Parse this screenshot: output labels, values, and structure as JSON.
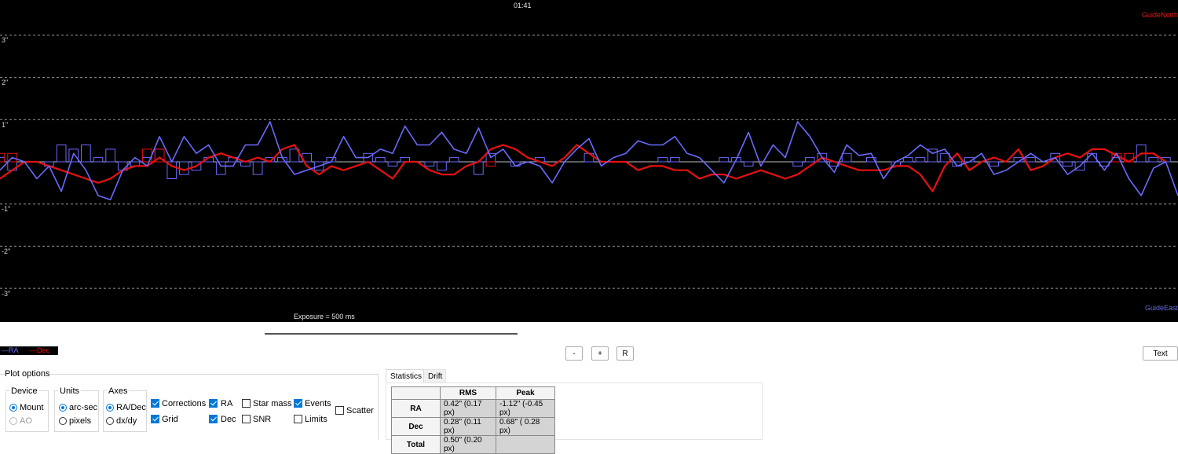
{
  "plot": {
    "time_label": "01:41",
    "y_ticks": [
      "3\"",
      "2\"",
      "1\"",
      "-1\"",
      "-2\"",
      "-3\""
    ],
    "guide_north": "GuideNorth",
    "guide_east": "GuideEast",
    "exposure": "Exposure = 500 ms",
    "colors": {
      "ra": "#6a6aff",
      "dec": "#e81010",
      "grid": "#9a9a9a",
      "background": "#000000"
    }
  },
  "legend": {
    "ra_label": "—RA",
    "dec_label": "—Dec"
  },
  "zoom_buttons": {
    "minus": "-",
    "plus": "+",
    "reset": "R"
  },
  "text_button": "Text",
  "plot_options": {
    "title": "Plot options",
    "device": {
      "title": "Device",
      "options": [
        "Mount",
        "AO"
      ],
      "selected": "Mount"
    },
    "units": {
      "title": "Units",
      "options": [
        "arc-sec",
        "pixels"
      ],
      "selected": "arc-sec"
    },
    "axes": {
      "title": "Axes",
      "options": [
        "RA/Dec",
        "dx/dy"
      ],
      "selected": "RA/Dec"
    },
    "checkboxes": [
      {
        "label": "Corrections",
        "checked": true
      },
      {
        "label": "Grid",
        "checked": true
      },
      {
        "label": "RA",
        "checked": true
      },
      {
        "label": "Dec",
        "checked": true
      },
      {
        "label": "Star mass",
        "checked": false
      },
      {
        "label": "SNR",
        "checked": false
      },
      {
        "label": "Events",
        "checked": true
      },
      {
        "label": "Limits",
        "checked": false
      },
      {
        "label": "Scatter",
        "checked": false
      }
    ]
  },
  "tabs": {
    "statistics": "Statistics",
    "drift": "Drift"
  },
  "stats": {
    "headers": [
      "RMS",
      "Peak"
    ],
    "rows": [
      {
        "label": "RA",
        "rms": "0.42\" (0.17 px)",
        "peak": "-1.12\" (-0.45 px)"
      },
      {
        "label": "Dec",
        "rms": "0.28\" (0.11 px)",
        "peak": "0.68\" ( 0.28 px)"
      },
      {
        "label": "Total",
        "rms": "0.50\" (0.20 px)",
        "peak": ""
      }
    ]
  },
  "chart_data": {
    "type": "line",
    "ylim": [
      -3.8,
      3.8
    ],
    "y_unit": "arc-sec",
    "series": [
      {
        "name": "RA",
        "values": [
          -0.2,
          0.1,
          0.0,
          -0.4,
          -0.1,
          -0.7,
          0.2,
          -0.2,
          -0.8,
          -0.9,
          -0.2,
          0.1,
          -0.1,
          0.6,
          0.0,
          0.6,
          0.2,
          0.4,
          -0.1,
          -0.1,
          0.4,
          0.4,
          0.95,
          0.1,
          -0.3,
          -0.2,
          -0.1,
          0.0,
          0.6,
          0.1,
          0.1,
          0.3,
          0.2,
          0.85,
          0.4,
          0.4,
          0.7,
          0.3,
          0.2,
          0.8,
          0.1,
          0.3,
          -0.1,
          0.0,
          -0.1,
          -0.5,
          0.0,
          0.3,
          0.55,
          -0.1,
          0.1,
          0.2,
          0.5,
          0.4,
          0.4,
          0.6,
          0.2,
          0.1,
          -0.2,
          -0.5,
          0.05,
          0.7,
          -0.1,
          0.4,
          0.1,
          0.95,
          0.6,
          0.1,
          -0.25,
          0.4,
          0.15,
          0.2,
          -0.4,
          0.0,
          0.15,
          0.4,
          0.2,
          0.3,
          -0.1,
          0.0,
          0.2,
          -0.3,
          -0.2,
          0.0,
          0.2,
          0.0,
          0.1,
          -0.3,
          -0.1,
          0.2,
          -0.2,
          0.2,
          -0.4,
          -0.8,
          -0.15,
          0.0,
          -0.8
        ]
      },
      {
        "name": "Dec",
        "values": [
          -0.4,
          -0.2,
          0.0,
          0.0,
          -0.1,
          -0.2,
          -0.3,
          -0.4,
          -0.5,
          -0.4,
          -0.2,
          -0.1,
          -0.1,
          0.1,
          -0.1,
          -0.2,
          -0.1,
          0.1,
          0.2,
          0.1,
          0.0,
          0.1,
          0.0,
          0.3,
          0.4,
          -0.1,
          -0.3,
          -0.1,
          -0.2,
          -0.1,
          0.0,
          -0.2,
          -0.4,
          0.0,
          0.0,
          -0.2,
          -0.3,
          -0.3,
          -0.1,
          0.0,
          0.3,
          0.4,
          0.3,
          0.1,
          0.0,
          -0.1,
          0.1,
          0.4,
          0.2,
          0.0,
          0.0,
          0.0,
          -0.2,
          -0.1,
          -0.1,
          -0.2,
          -0.2,
          -0.4,
          -0.3,
          -0.3,
          -0.4,
          -0.3,
          -0.2,
          -0.3,
          -0.4,
          -0.3,
          -0.1,
          0.1,
          0.0,
          -0.1,
          -0.2,
          -0.2,
          -0.2,
          -0.1,
          -0.1,
          -0.3,
          -0.7,
          -0.1,
          0.2,
          -0.2,
          0.0,
          0.1,
          0.0,
          0.3,
          -0.2,
          -0.1,
          0.1,
          0.2,
          0.1,
          0.3,
          0.3,
          0.15,
          0.0,
          0.2,
          0.2,
          0.0
        ]
      },
      {
        "name": "RA Corrections",
        "values": [
          0.1,
          -0.2,
          0.0,
          0.0,
          -0.1,
          0.4,
          0.3,
          0.4,
          0.1,
          0.3,
          -0.2,
          -0.1,
          0.1,
          0.3,
          -0.4,
          -0.3,
          -0.2,
          0.1,
          -0.3,
          0.1,
          -0.1,
          -0.3,
          0.1,
          0.1,
          0.3,
          0.2,
          -0.2,
          0.1,
          0.0,
          0.0,
          0.2,
          0.1,
          -0.1,
          0.1,
          0.0,
          -0.1,
          -0.2,
          0.1,
          0.0,
          -0.3,
          0.2,
          0.0,
          -0.1,
          0.0,
          0.1,
          0.0,
          0.0,
          0.0,
          0.2,
          0.0,
          0.0,
          0.0,
          0.0,
          0.0,
          0.1,
          0.1,
          0.0,
          0.0,
          0.0,
          0.1,
          0.1,
          -0.1,
          0.0,
          0.0,
          0.0,
          -0.1,
          0.1,
          0.2,
          -0.1,
          0.2,
          0.0,
          0.1,
          0.0,
          -0.1,
          0.1,
          0.1,
          0.3,
          0.2,
          -0.1,
          0.1,
          0.0,
          -0.1,
          0.0,
          0.1,
          0.1,
          0.0,
          0.2,
          -0.1,
          -0.2,
          0.2,
          -0.1,
          0.1,
          0.0,
          0.4,
          0.1,
          0.1,
          0.0
        ]
      },
      {
        "name": "Dec Corrections",
        "values": [
          0.2,
          0.2,
          0.0,
          0.0,
          0.0,
          0.0,
          0.0,
          0.0,
          0.0,
          0.0,
          0.0,
          0.0,
          0.3,
          0.3,
          0.0,
          0.0,
          0.0,
          0.0,
          0.0,
          0.0,
          0.0,
          0.0,
          0.0,
          0.0,
          0.0,
          0.0,
          0.0,
          0.0,
          0.0,
          0.0,
          0.0,
          0.0,
          0.0,
          0.0,
          0.0,
          0.0,
          0.0,
          0.0,
          0.0,
          0.0,
          -0.1,
          0.0,
          0.0,
          0.0,
          0.0,
          0.0,
          0.0,
          0.0,
          0.0,
          0.0,
          0.0,
          0.0,
          0.0,
          0.0,
          0.0,
          0.0,
          0.0,
          0.0,
          0.0,
          0.0,
          0.0,
          0.0,
          0.0,
          0.0,
          0.0,
          0.0,
          0.0,
          0.0,
          0.0,
          0.0,
          0.0,
          0.0,
          0.0,
          0.0,
          0.0,
          0.0,
          0.0,
          0.0,
          0.0,
          0.0,
          0.0,
          0.0,
          0.0,
          0.0,
          0.0,
          0.0,
          0.0,
          0.0,
          0.0,
          0.0,
          0.0,
          0.2,
          0.2,
          0.0,
          0.0,
          0.0,
          0.0
        ]
      }
    ]
  }
}
